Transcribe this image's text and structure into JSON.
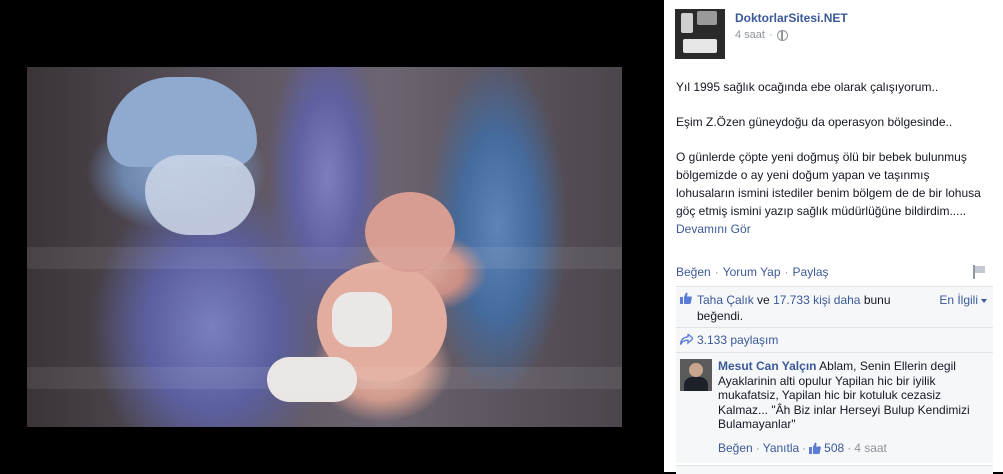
{
  "post": {
    "page_name": "DoktorlarSitesi.NET",
    "time": "4 saat",
    "paragraphs": [
      "Yıl 1995 sağlık ocağında ebe olarak çalışıyorum..",
      "Eşim Z.Özen güneydoğu da operasyon bölgesinde..",
      "O günlerde çöpte yeni doğmuş ölü bir bebek bulunmuş bölgemizde o ay yeni doğum yapan ve taşınmış lohusaların ismini istediler benim bölgem de de bir lohusa göç etmiş ismini yazıp sağlık müdürlüğüne bildirdim....."
    ],
    "see_more": "Devamını Gör"
  },
  "actions": {
    "like": "Beğen",
    "comment": "Yorum Yap",
    "share": "Paylaş",
    "separator": "·"
  },
  "likes": {
    "name": "Taha Çalık",
    "and": "ve",
    "others": "17.733 kişi daha",
    "suffix": "bunu beğendi.",
    "sort": "En İlgili"
  },
  "shares": {
    "text": "3.133 paylaşım"
  },
  "comment": {
    "author": "Mesut Can Yalçın",
    "text": "Ablam, Senin Ellerin degil Ayaklarinin alti opulur Yapilan hic bir iyilik mukafatsiz, Yapilan hic bir kotuluk cezasiz Kalmaz... \"Âh Biz inlar Herseyi Bulup Kendimizi Bulamayanlar\"",
    "like": "Beğen",
    "reply": "Yanıtla",
    "like_count": "508",
    "time": "4 saat"
  },
  "colors": {
    "link": "#3b5998",
    "muted": "#90949c",
    "ufi_bg": "#f6f7f9"
  }
}
